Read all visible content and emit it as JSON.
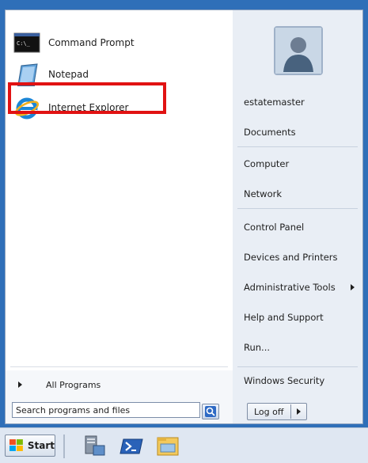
{
  "start_menu": {
    "pinned": [
      {
        "label": "Command Prompt",
        "icon": "command-prompt-icon"
      },
      {
        "label": "Notepad",
        "icon": "notepad-icon"
      },
      {
        "label": "Internet Explorer",
        "icon": "internet-explorer-icon"
      }
    ],
    "cmd_icon_text": "C:\\_",
    "all_programs_label": "All Programs",
    "search": {
      "value": "Search programs and files",
      "placeholder": "Search programs and files"
    },
    "right_items": {
      "user": "estatemaster",
      "documents": "Documents",
      "computer": "Computer",
      "network": "Network",
      "control_panel": "Control Panel",
      "devices": "Devices and Printers",
      "admin_tools": "Administrative Tools",
      "help": "Help and Support",
      "run": "Run...",
      "security": "Windows Security"
    },
    "logoff_label": "Log off",
    "highlight_color": "#e11212"
  },
  "taskbar": {
    "start_label": "Start",
    "pinned_icons": [
      "server-manager-icon",
      "powershell-icon",
      "file-explorer-icon"
    ]
  }
}
